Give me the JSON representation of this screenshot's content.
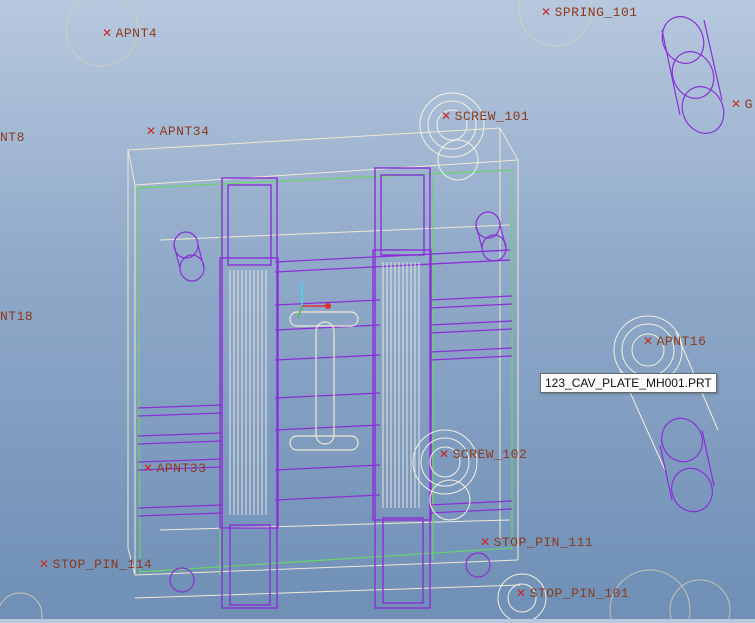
{
  "viewport": {
    "background_top": "#b7c8de",
    "background_bottom": "#6f8fb6"
  },
  "tooltip": {
    "text": "123_CAV_PLATE_MH001.PRT"
  },
  "datum_points": {
    "apnt4": "APNT4",
    "spring_101": "SPRING_101",
    "g_partial": "G",
    "apnt8": "NT8",
    "apnt34": "APNT34",
    "screw_101": "SCREW_101",
    "apnt18": "NT18",
    "apnt16": "APNT16",
    "apnt33": "APNT33",
    "screw_102": "SCREW_102",
    "stop_pin_111": "STOP_PIN_111",
    "stop_pin_114": "STOP_PIN_114",
    "stop_pin_101": "STOP_PIN_101"
  },
  "colors": {
    "wire_purple": "#8a2fd6",
    "wire_green": "#6ad46a",
    "wire_light": "#efe9d2",
    "datum_x": "#c8281e",
    "datum_text": "#8b3a1e"
  }
}
